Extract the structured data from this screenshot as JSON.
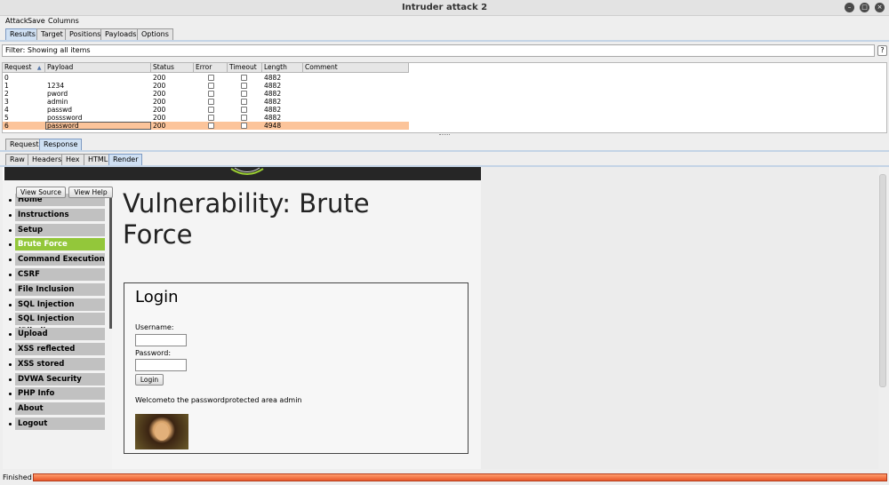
{
  "window": {
    "title": "Intruder attack 2"
  },
  "menu": [
    "Attack",
    "Save",
    "Columns"
  ],
  "main_tabs": [
    "Results",
    "Target",
    "Positions",
    "Payloads",
    "Options"
  ],
  "filter": {
    "text": "Filter: Showing all items",
    "help": "?"
  },
  "table": {
    "headers": [
      "Request",
      "Payload",
      "Status",
      "Error",
      "Timeout",
      "Length",
      "Comment"
    ],
    "sort_indicator": "▲",
    "rows": [
      {
        "request": "0",
        "payload": "",
        "status": "200",
        "length": "4882"
      },
      {
        "request": "1",
        "payload": "1234",
        "status": "200",
        "length": "4882"
      },
      {
        "request": "2",
        "payload": "pword",
        "status": "200",
        "length": "4882"
      },
      {
        "request": "3",
        "payload": "admin",
        "status": "200",
        "length": "4882"
      },
      {
        "request": "4",
        "payload": "passwd",
        "status": "200",
        "length": "4882"
      },
      {
        "request": "5",
        "payload": "posssword",
        "status": "200",
        "length": "4882"
      },
      {
        "request": "6",
        "payload": "password",
        "status": "200",
        "length": "4948"
      }
    ],
    "selected_row": 6
  },
  "reqres_tabs": [
    "Request",
    "Response"
  ],
  "view_tabs": [
    "Raw",
    "Headers",
    "Hex",
    "HTML",
    "Render"
  ],
  "page": {
    "view_source": "View Source",
    "view_help": "View Help",
    "nav": [
      "Home",
      "Instructions",
      "Setup",
      "Brute Force",
      "Command Execution",
      "CSRF",
      "File Inclusion",
      "SQL Injection",
      "SQL Injection (Blind)",
      "Upload",
      "XSS reflected",
      "XSS stored",
      "DVWA Security",
      "PHP Info",
      "About",
      "Logout"
    ],
    "nav_active": "Brute Force",
    "heading_line1": "Vulnerability: Brute",
    "heading_line2": "Force",
    "login_title": "Login",
    "username_label": "Username:",
    "password_label": "Password:",
    "login_button": "Login",
    "welcome": "Welcometo the passwordprotected area admin"
  },
  "status": {
    "text": "Finished",
    "progress": 1.0
  },
  "colors": {
    "selected_row": "#fcc49a",
    "nav_active": "#93c73a",
    "progress": "#f0703f",
    "active_tab": "#cfe0f3"
  }
}
